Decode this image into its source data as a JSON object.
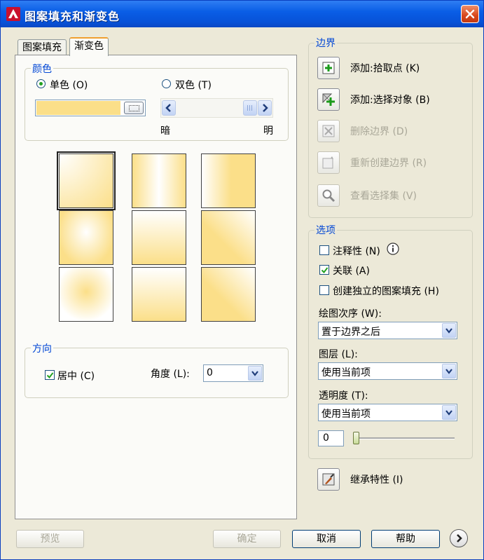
{
  "window": {
    "title": "图案填充和渐变色",
    "close_label": "×"
  },
  "tabs": [
    {
      "label": "图案填充",
      "active": false
    },
    {
      "label": "渐变色",
      "active": true
    }
  ],
  "color_group": {
    "label": "颜色",
    "single_color": "单色 (O)",
    "two_color": "双色 (T)",
    "single_selected": true,
    "swatch_color": "#FBDF89",
    "dark_label": "暗",
    "light_label": "明",
    "shade_level": 0.85
  },
  "direction_group": {
    "label": "方向",
    "center_label": "居中 (C)",
    "center_checked": true,
    "angle_label": "角度 (L):",
    "angle_value": "0"
  },
  "boundary_group": {
    "label": "边界",
    "buttons": [
      {
        "label": "添加:拾取点 (K)",
        "icon": "pick-point-icon",
        "enabled": true
      },
      {
        "label": "添加:选择对象 (B)",
        "icon": "select-objects-icon",
        "enabled": true
      },
      {
        "label": "删除边界 (D)",
        "icon": "remove-boundary-icon",
        "enabled": false
      },
      {
        "label": "重新创建边界 (R)",
        "icon": "recreate-boundary-icon",
        "enabled": false
      },
      {
        "label": "查看选择集 (V)",
        "icon": "magnifier-icon",
        "enabled": false
      }
    ]
  },
  "options_group": {
    "label": "选项",
    "annotative": "注释性 (N)",
    "annotative_checked": false,
    "associative": "关联 (A)",
    "associative_checked": true,
    "separate": "创建独立的图案填充 (H)",
    "separate_checked": false,
    "draw_order_label": "绘图次序 (W):",
    "draw_order_value": "置于边界之后",
    "layer_label": "图层 (L):",
    "layer_value": "使用当前项",
    "transparency_label": "透明度 (T):",
    "transparency_value": "使用当前项",
    "transparency_amount": "0",
    "info_icon": "info-icon"
  },
  "inherit_label": "继承特性 (I)",
  "bottom_buttons": {
    "preview": "预览",
    "ok": "确定",
    "cancel": "取消",
    "help": "帮助"
  }
}
